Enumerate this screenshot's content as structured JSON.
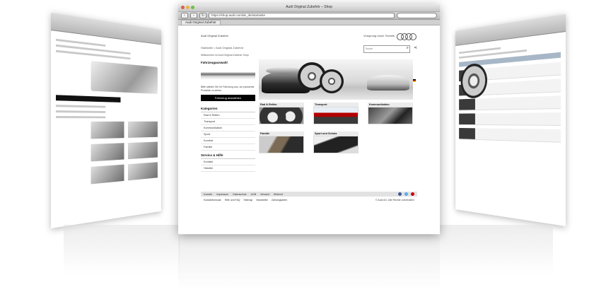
{
  "main_window": {
    "title": "Audi Original Zubehör – Shop",
    "url": "https://shop.audi.com/de_de/startseite",
    "tab": "Audi Original Zubehör",
    "brand": "Audi Original Zubehör",
    "logo_text": "Vorsprung durch Technik",
    "breadcrumb": "Startseite > Audi Original Zubehör",
    "search_placeholder": "Suche",
    "infoline": "Willkommen im Audi Original Zubehör Shop",
    "left": {
      "heading": "Fahrzeugauswahl",
      "text": "Bitte wählen Sie Ihr Fahrzeug aus, um passende Produkte zu sehen",
      "button": "Fahrzeug auswählen",
      "categories_title": "Kategorien",
      "categories": [
        "Rad & Reifen",
        "Transport",
        "Kommunikation",
        "Sport",
        "Komfort",
        "Familie"
      ],
      "service_title": "Service & Hilfe",
      "service_items": [
        "Kontakt",
        "Händler"
      ]
    },
    "tiles": [
      {
        "label": "Rad & Reifen"
      },
      {
        "label": "Transport"
      },
      {
        "label": "Kommunikation"
      },
      {
        "label": "Familie"
      },
      {
        "label": "Sport und Schutz"
      }
    ],
    "footer": {
      "items": [
        "Kontakt",
        "Impressum",
        "Datenschutz",
        "AGB",
        "Versand",
        "Widerruf"
      ],
      "links": [
        "Kontaktformular",
        "Hilfe und FAQ",
        "Sitemap",
        "Newsletter",
        "Zahlungsarten"
      ],
      "copyright": "© Audi AG. Alle Rechte vorbehalten",
      "social_icons": [
        "facebook-icon",
        "twitter-icon",
        "youtube-icon"
      ]
    }
  },
  "colors": {
    "accent_red": "#cc0000",
    "dark": "#000000"
  }
}
